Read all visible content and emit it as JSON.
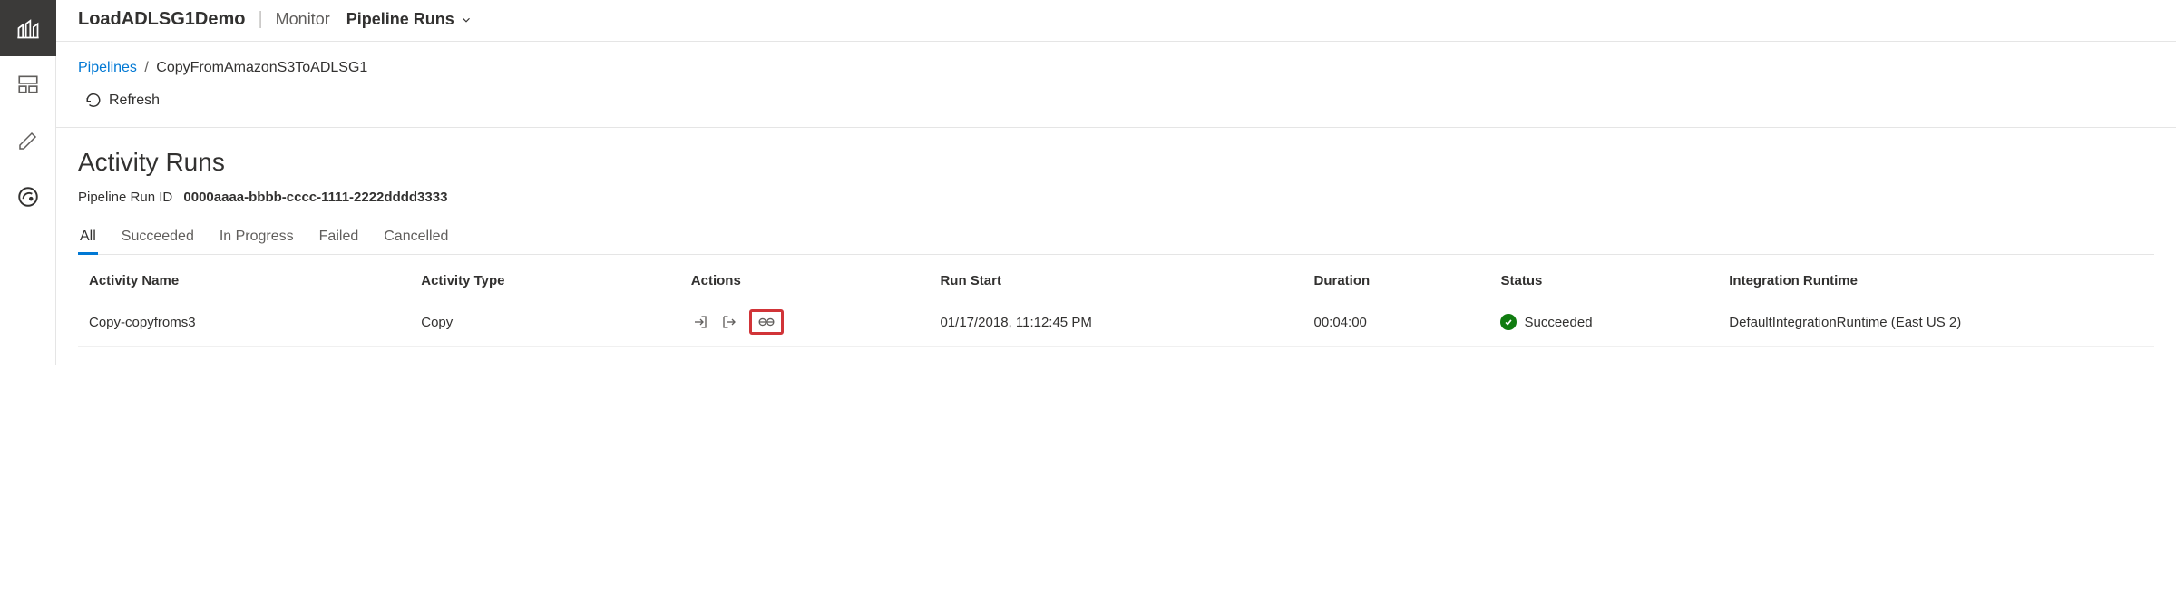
{
  "header": {
    "resource_name": "LoadADLSG1Demo",
    "section": "Monitor",
    "sub_section": "Pipeline Runs"
  },
  "breadcrumb": {
    "root": "Pipelines",
    "current": "CopyFromAmazonS3ToADLSG1"
  },
  "refresh_label": "Refresh",
  "page_title": "Activity Runs",
  "run_id": {
    "label": "Pipeline Run ID",
    "value": "0000aaaa-bbbb-cccc-1111-2222dddd3333"
  },
  "tabs": [
    "All",
    "Succeeded",
    "In Progress",
    "Failed",
    "Cancelled"
  ],
  "columns": {
    "activity_name": "Activity Name",
    "activity_type": "Activity Type",
    "actions": "Actions",
    "run_start": "Run Start",
    "duration": "Duration",
    "status": "Status",
    "integration_runtime": "Integration Runtime"
  },
  "rows": [
    {
      "activity_name": "Copy-copyfroms3",
      "activity_type": "Copy",
      "run_start": "01/17/2018, 11:12:45 PM",
      "duration": "00:04:00",
      "status": "Succeeded",
      "integration_runtime": "DefaultIntegrationRuntime (East US 2)"
    }
  ]
}
